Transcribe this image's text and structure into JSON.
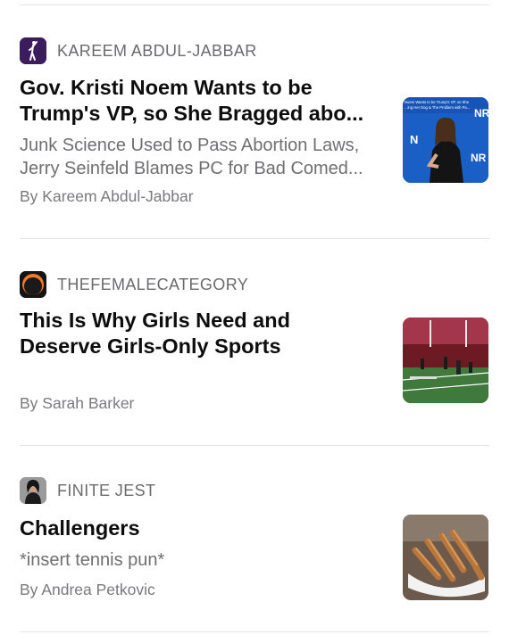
{
  "articles": [
    {
      "publication": "KAREEM ABDUL-JABBAR",
      "publication_icon": "basketball-player-icon",
      "title_line1": "Gov. Kristi Noem Wants to be",
      "title_line2": "Trump's VP, so She Bragged abo...",
      "subtitle_line1": "Junk Science Used to Pass Abortion Laws,",
      "subtitle_line2": "Jerry Seinfeld Blames PC for Bad Comed...",
      "byline": "By Kareem Abdul-Jabbar",
      "thumbnail_text_1": "Noem Wants to be Trump's VP, so She",
      "thumbnail_text_2": "...ing Her Dog & The Problem with Pa...",
      "thumbnail_logo": "NR"
    },
    {
      "publication": "THEFEMALECATEGORY",
      "publication_icon": "female-category-logo",
      "title_line1": "This Is Why Girls Need and",
      "title_line2": "Deserve Girls-Only Sports",
      "byline": "By Sarah Barker"
    },
    {
      "publication": "FINITE JEST",
      "publication_icon": "author-avatar",
      "title_line1": "Challengers",
      "subtitle_line1": "*insert tennis pun*",
      "byline": "By Andrea Petkovic"
    }
  ]
}
